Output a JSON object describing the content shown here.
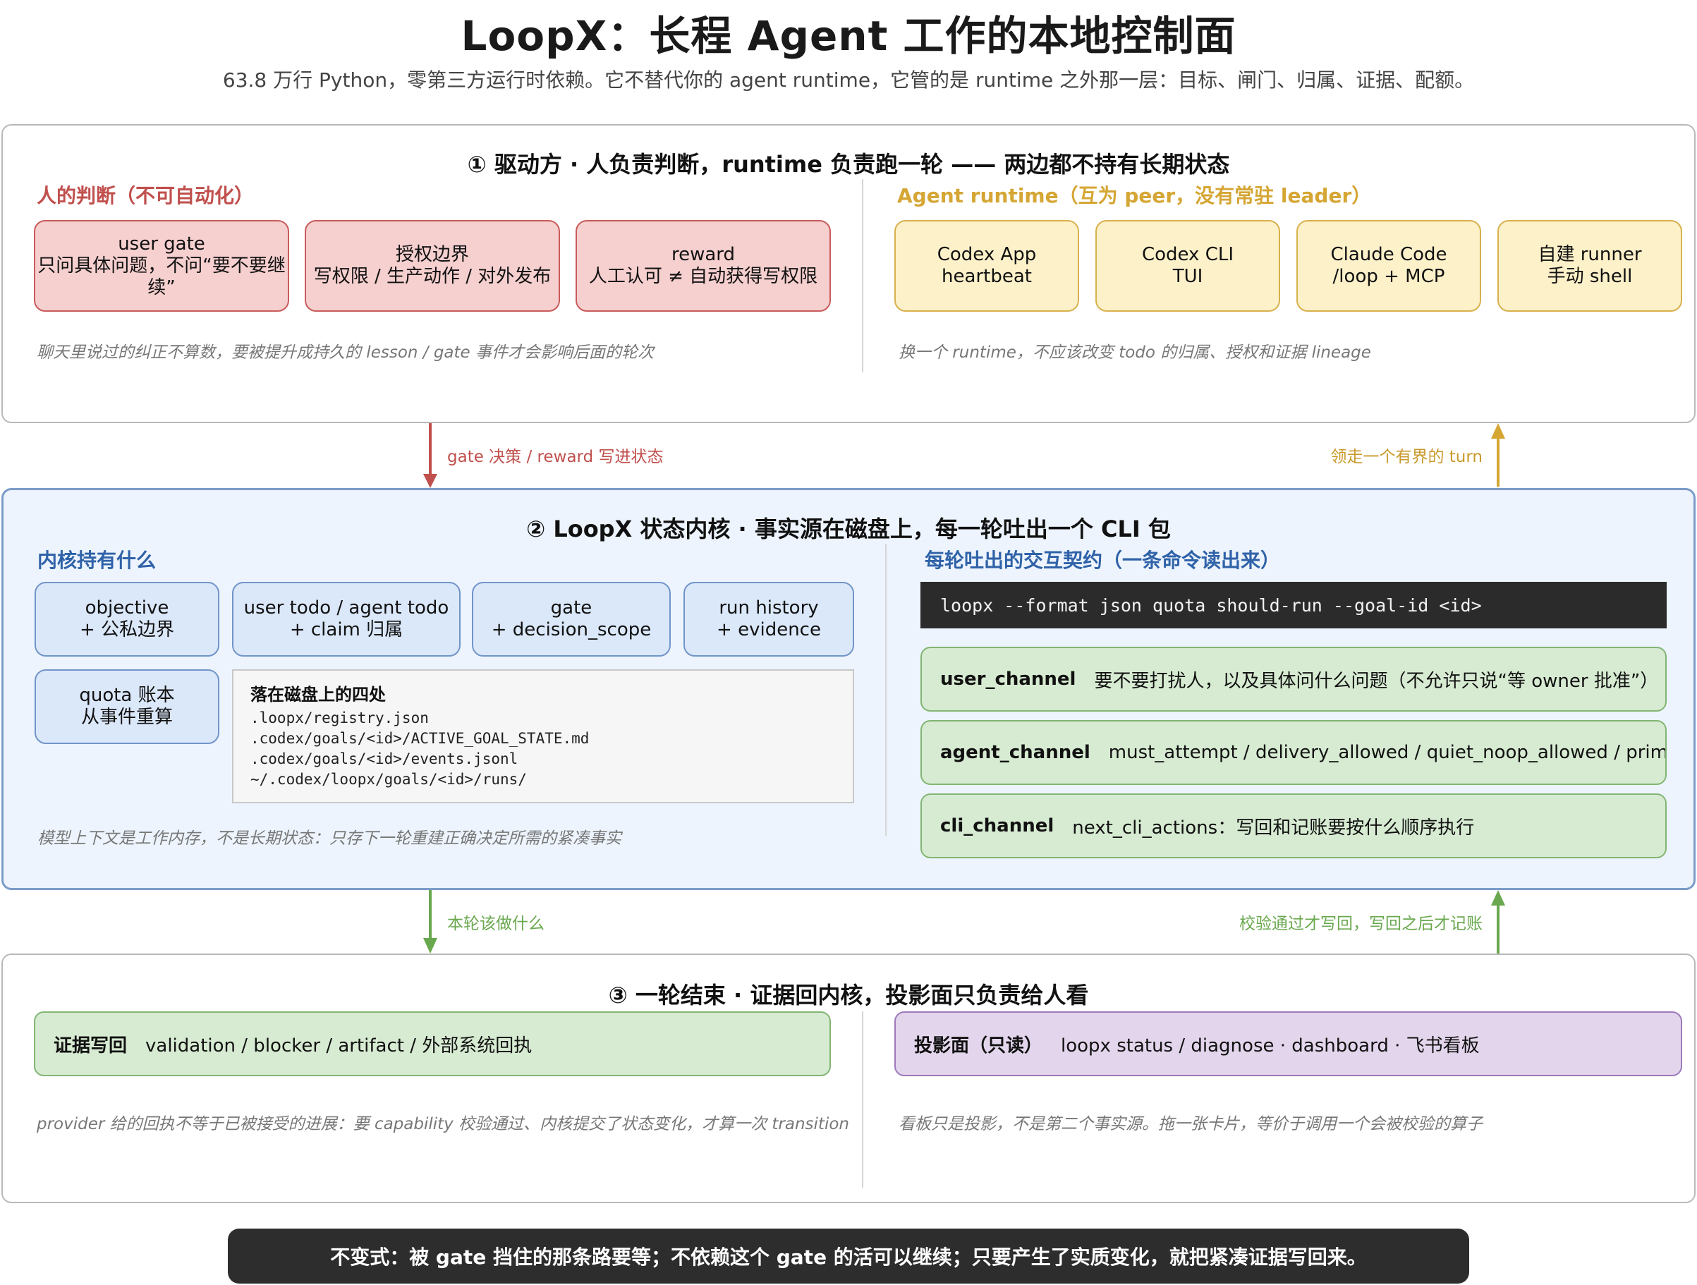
{
  "header": {
    "title": "LoopX：长程 Agent 工作的本地控制面",
    "subtitle": "63.8 万行 Python，零第三方运行时依赖。它不替代你的 agent runtime，它管的是 runtime 之外那一层：目标、闸门、归属、证据、配额。"
  },
  "panel1": {
    "title": "① 驱动方 · 人负责判断，runtime 负责跑一轮 —— 两边都不持有长期状态",
    "left_head": "人的判断（不可自动化）",
    "human_boxes": [
      {
        "line1": "user gate",
        "line2": "只问具体问题，不问“要不要继",
        "line3": "续”"
      },
      {
        "line1": "授权边界",
        "line2": "写权限 / 生产动作 / 对外发布"
      },
      {
        "line1": "reward",
        "line2": "人工认可 ≠ 自动获得写权限"
      }
    ],
    "left_note": "聊天里说过的纠正不算数，要被提升成持久的 lesson / gate 事件才会影响后面的轮次",
    "right_head": "Agent runtime（互为 peer，没有常驻 leader）",
    "runtime_boxes": [
      {
        "line1": "Codex App",
        "line2": "heartbeat"
      },
      {
        "line1": "Codex CLI",
        "line2": "TUI"
      },
      {
        "line1": "Claude Code",
        "line2": "/loop + MCP"
      },
      {
        "line1": "自建 runner",
        "line2": "手动 shell"
      }
    ],
    "right_note": "换一个 runtime，不应该改变 todo 的归属、授权和证据 lineage"
  },
  "arrows": {
    "down1": "gate 决策 / reward 写进状态",
    "up1": "领走一个有界的 turn",
    "down2": "本轮该做什么",
    "up2": "校验通过才写回，写回之后才记账",
    "colors": {
      "red": "#c0504d",
      "yellow": "#d5a634",
      "green": "#6aa84f"
    }
  },
  "panel2": {
    "title": "② LoopX 状态内核 · 事实源在磁盘上，每一轮吐出一个 CLI 包",
    "left_head": "内核持有什么",
    "kernel_boxes": [
      {
        "line1": "objective",
        "line2": "+ 公私边界"
      },
      {
        "line1": "user todo / agent todo",
        "line2": "+ claim 归属"
      },
      {
        "line1": "gate",
        "line2": "+ decision_scope"
      },
      {
        "line1": "run history",
        "line2": "+ evidence"
      }
    ],
    "quota_box": {
      "line1": "quota 账本",
      "line2": "从事件重算"
    },
    "disk": {
      "head": "落在磁盘上的四处",
      "lines": [
        ".loopx/registry.json",
        ".codex/goals/<id>/ACTIVE_GOAL_STATE.md",
        ".codex/goals/<id>/events.jsonl",
        "~/.codex/loopx/goals/<id>/runs/"
      ]
    },
    "left_note": "模型上下文是工作内存，不是长期状态：只存下一轮重建正确决定所需的紧凑事实",
    "right_head": "每轮吐出的交互契约（一条命令读出来）",
    "command": "loopx --format json quota should-run --goal-id <id>",
    "channels": [
      {
        "name": "user_channel",
        "desc": "要不要打扰人，以及具体问什么问题（不允许只说“等 owner 批准”）"
      },
      {
        "name": "agent_channel",
        "desc": "must_attempt / delivery_allowed / quiet_noop_allowed / primary_action"
      },
      {
        "name": "cli_channel",
        "desc": "next_cli_actions：写回和记账要按什么顺序执行"
      }
    ]
  },
  "panel3": {
    "title": "③ 一轮结束 · 证据回内核，投影面只负责给人看",
    "evidence": {
      "name": "证据写回",
      "desc": "validation / blocker / artifact / 外部系统回执"
    },
    "projection": {
      "name": "投影面（只读）",
      "desc": "loopx status / diagnose · dashboard · 飞书看板"
    },
    "left_note": "provider 给的回执不等于已被接受的进展：要 capability 校验通过、内核提交了状态变化，才算一次 transition",
    "right_note": "看板只是投影，不是第二个事实源。拖一张卡片，等价于调用一个会被校验的算子"
  },
  "footer": "不变式：被 gate 挡住的那条路要等；不依赖这个 gate 的活可以继续；只要产生了实质变化，就把紧凑证据写回来。"
}
